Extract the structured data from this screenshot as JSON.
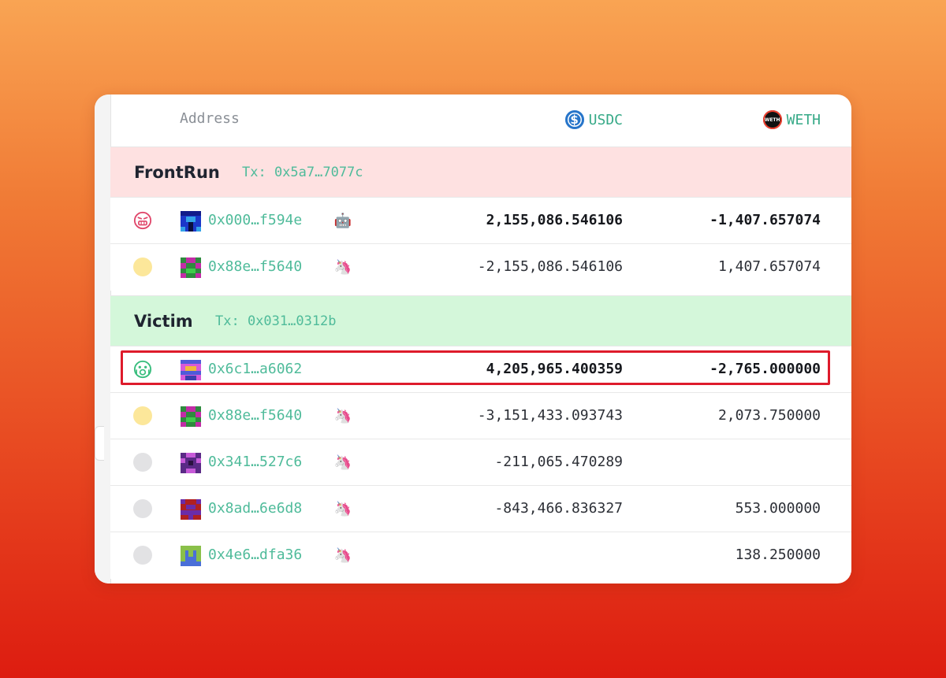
{
  "header": {
    "address_label": "Address",
    "tokens": [
      {
        "symbol": "USDC",
        "icon": "usdc-icon",
        "color": "#2775ca"
      },
      {
        "symbol": "WETH",
        "icon": "weth-icon",
        "color": "#111111"
      }
    ]
  },
  "groups": [
    {
      "name": "FrontRun",
      "tx": "Tx: 0x5a7…7077c",
      "background": "#fee1e1",
      "rows": [
        {
          "status": "angry-face",
          "address": "0x000…f594e",
          "badge": "robot-icon",
          "usdc": "2,155,086.546106",
          "weth": "-1,407.657074",
          "bold": true
        },
        {
          "status": "yellow",
          "address": "0x88e…f5640",
          "badge": "unicorn-icon",
          "usdc": "-2,155,086.546106",
          "weth": "1,407.657074",
          "bold": false
        }
      ]
    },
    {
      "name": "Victim",
      "tx": "Tx: 0x031…0312b",
      "background": "#d4f7da",
      "rows": [
        {
          "status": "scared-face",
          "address": "0x6c1…a6062",
          "badge": "",
          "usdc": "4,205,965.400359",
          "weth": "-2,765.000000",
          "bold": true,
          "highlighted": true
        },
        {
          "status": "yellow",
          "address": "0x88e…f5640",
          "badge": "unicorn-icon",
          "usdc": "-3,151,433.093743",
          "weth": "2,073.750000",
          "bold": false
        },
        {
          "status": "gray",
          "address": "0x341…527c6",
          "badge": "unicorn-icon",
          "usdc": "-211,065.470289",
          "weth": "",
          "bold": false
        },
        {
          "status": "gray",
          "address": "0x8ad…6e6d8",
          "badge": "unicorn-icon",
          "usdc": "-843,466.836327",
          "weth": "553.000000",
          "bold": false
        },
        {
          "status": "gray",
          "address": "0x4e6…dfa36",
          "badge": "unicorn-icon",
          "usdc": "",
          "weth": "138.250000",
          "bold": false
        }
      ]
    }
  ],
  "colors": {
    "address_link": "#4fbb9a",
    "highlight_border": "#de1b2b"
  }
}
